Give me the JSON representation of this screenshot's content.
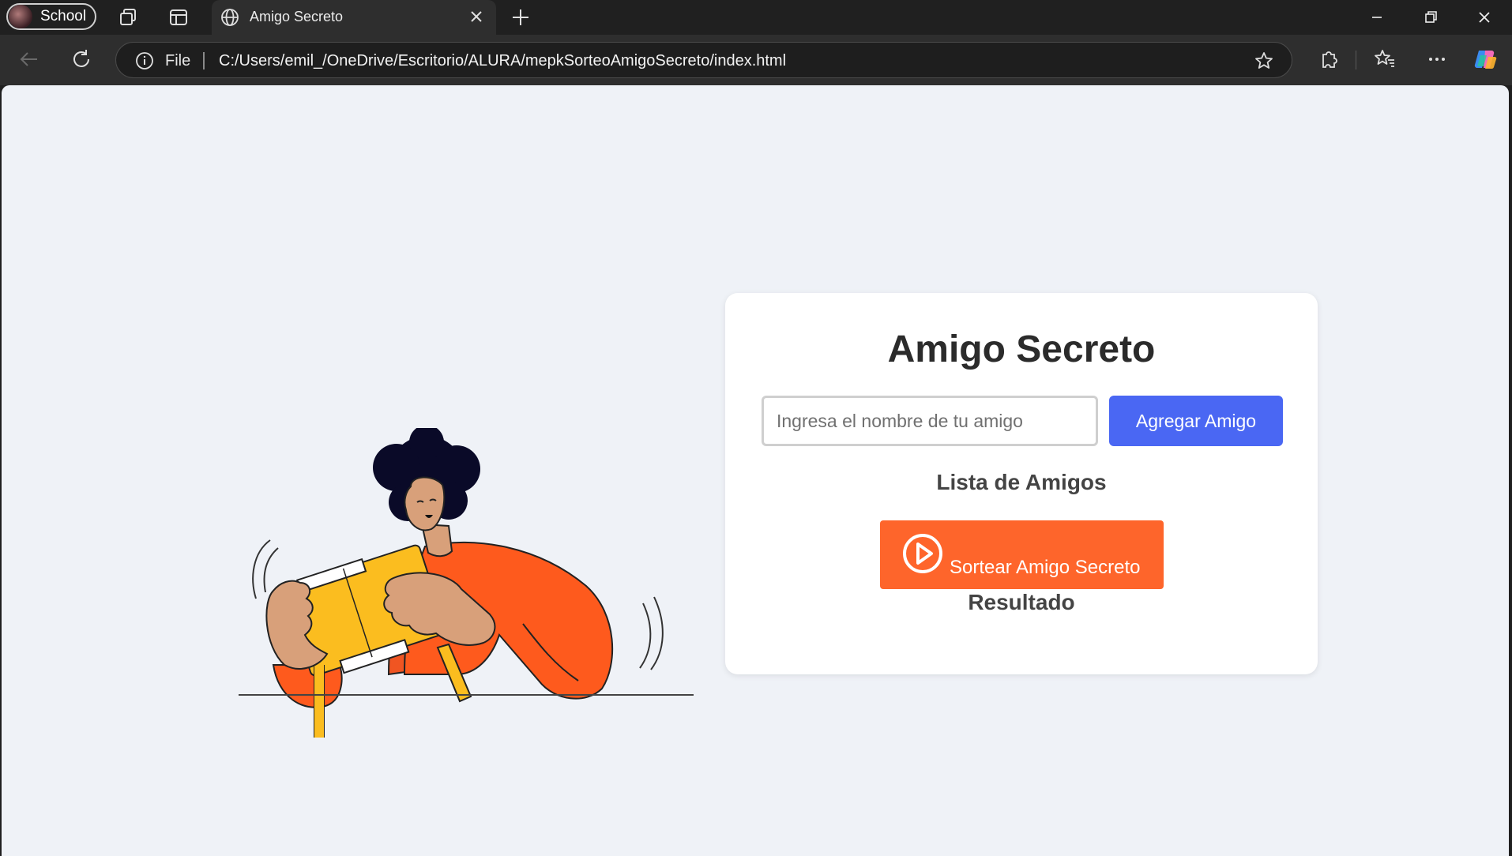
{
  "browser": {
    "profile_label": "School",
    "tab_title": "Amigo Secreto",
    "address": {
      "scheme_label": "File",
      "url": "C:/Users/emil_/OneDrive/Escritorio/ALURA/mepkSorteoAmigoSecreto/index.html"
    }
  },
  "app": {
    "title": "Amigo Secreto",
    "input": {
      "placeholder": "Ingresa el nombre de tu amigo",
      "value": ""
    },
    "add_button": "Agregar Amigo",
    "list_heading": "Lista de Amigos",
    "draw_button": "Sortear Amigo Secreto",
    "result_heading": "Resultado"
  },
  "colors": {
    "page_bg": "#eff2f7",
    "card_bg": "#ffffff",
    "add_button": "#4a67f3",
    "draw_button": "#fe652b",
    "browser_chrome": "#202020"
  },
  "icons": [
    "workspaces-icon",
    "tab-actions-icon",
    "globe-icon",
    "close-tab-icon",
    "new-tab-icon",
    "minimize-icon",
    "restore-icon",
    "close-window-icon",
    "back-icon",
    "refresh-icon",
    "info-icon",
    "favorite-star-icon",
    "extensions-icon",
    "favorites-icon",
    "more-icon",
    "copilot-icon",
    "play-icon"
  ]
}
